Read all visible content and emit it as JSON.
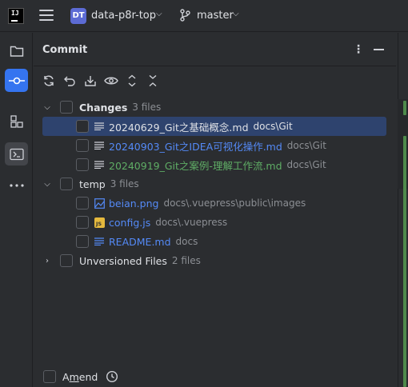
{
  "topbar": {
    "logo_text": "IJ",
    "project_badge": "DT",
    "project_name": "data-p8r-top",
    "branch_name": "master"
  },
  "strip": {
    "icons": [
      "project-folder-icon",
      "commit-icon",
      "structure-icon",
      "terminal-icon",
      "more-icon"
    ]
  },
  "panel": {
    "title": "Commit",
    "toolbar_icons": [
      "refresh-icon",
      "rollback-icon",
      "update-icon",
      "show-diff-icon",
      "expand-all-icon",
      "collapse-all-icon"
    ]
  },
  "tree": {
    "changes": {
      "label": "Changes",
      "count": "3 files",
      "files": [
        {
          "name": "20240629_Git之基础概念.md",
          "path": "docs\\Git",
          "color": "#dfe1e5"
        },
        {
          "name": "20240903_Git之IDEA可视化操作.md",
          "path": "docs\\Git",
          "color": "#548af7"
        },
        {
          "name": "20240919_Git之案例-理解工作流.md",
          "path": "docs\\Git",
          "color": "#5fad65"
        }
      ]
    },
    "temp": {
      "label": "temp",
      "count": "3 files",
      "files": [
        {
          "name": "beian.png",
          "path": "docs\\.vuepress\\public\\images",
          "color": "#548af7"
        },
        {
          "name": "config.js",
          "path": "docs\\.vuepress",
          "color": "#548af7"
        },
        {
          "name": "README.md",
          "path": "docs",
          "color": "#548af7"
        }
      ]
    },
    "unversioned": {
      "label": "Unversioned Files",
      "count": "2 files"
    }
  },
  "footer": {
    "amend_label": "Amend"
  }
}
